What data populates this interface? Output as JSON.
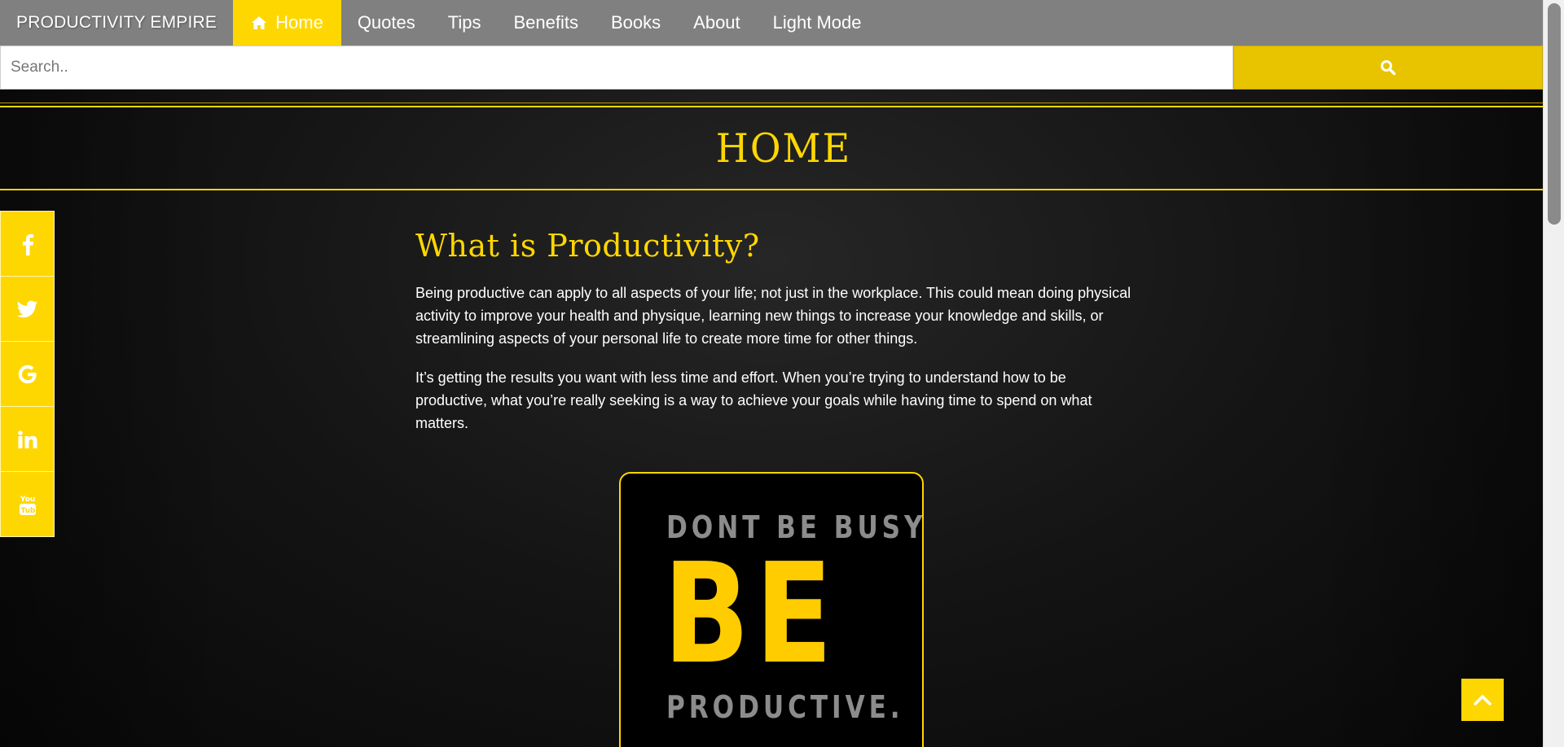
{
  "navbar": {
    "brand": "PRODUCTIVITY EMPIRE",
    "items": [
      {
        "label": "Home",
        "icon": "home-icon",
        "active": true
      },
      {
        "label": "Quotes"
      },
      {
        "label": "Tips"
      },
      {
        "label": "Benefits"
      },
      {
        "label": "Books"
      },
      {
        "label": "About"
      },
      {
        "label": "Light Mode"
      }
    ]
  },
  "search": {
    "placeholder": "Search..",
    "button_icon": "search-icon"
  },
  "header": {
    "title": "HOME"
  },
  "social": [
    {
      "icon": "facebook-icon",
      "glyph": "f"
    },
    {
      "icon": "twitter-icon",
      "glyph": "t"
    },
    {
      "icon": "google-icon",
      "glyph": "G"
    },
    {
      "icon": "linkedin-icon",
      "glyph": "in"
    },
    {
      "icon": "youtube-icon",
      "glyph": "You Tube"
    }
  ],
  "main": {
    "heading": "What is Productivity?",
    "paragraphs": [
      "Being productive can apply to all aspects of your life; not just in the workplace. This could mean doing physical activity to improve your health and physique, learning new things to increase your knowledge and skills, or streamlining aspects of your personal life to create more time for other things.",
      "It’s getting the results you want with less time and effort. When you’re trying to understand how to be productive, what you’re really seeking is a way to achieve your goals while having time to spend on what matters."
    ]
  },
  "poster": {
    "line1": "DONT BE BUSY",
    "big": "BE",
    "line3": "PRODUCTIVE."
  },
  "back_to_top": {
    "icon": "chevron-up-icon"
  },
  "colors": {
    "accent": "#ffd700",
    "navbar": "#808080",
    "search_button": "#e8c300"
  }
}
